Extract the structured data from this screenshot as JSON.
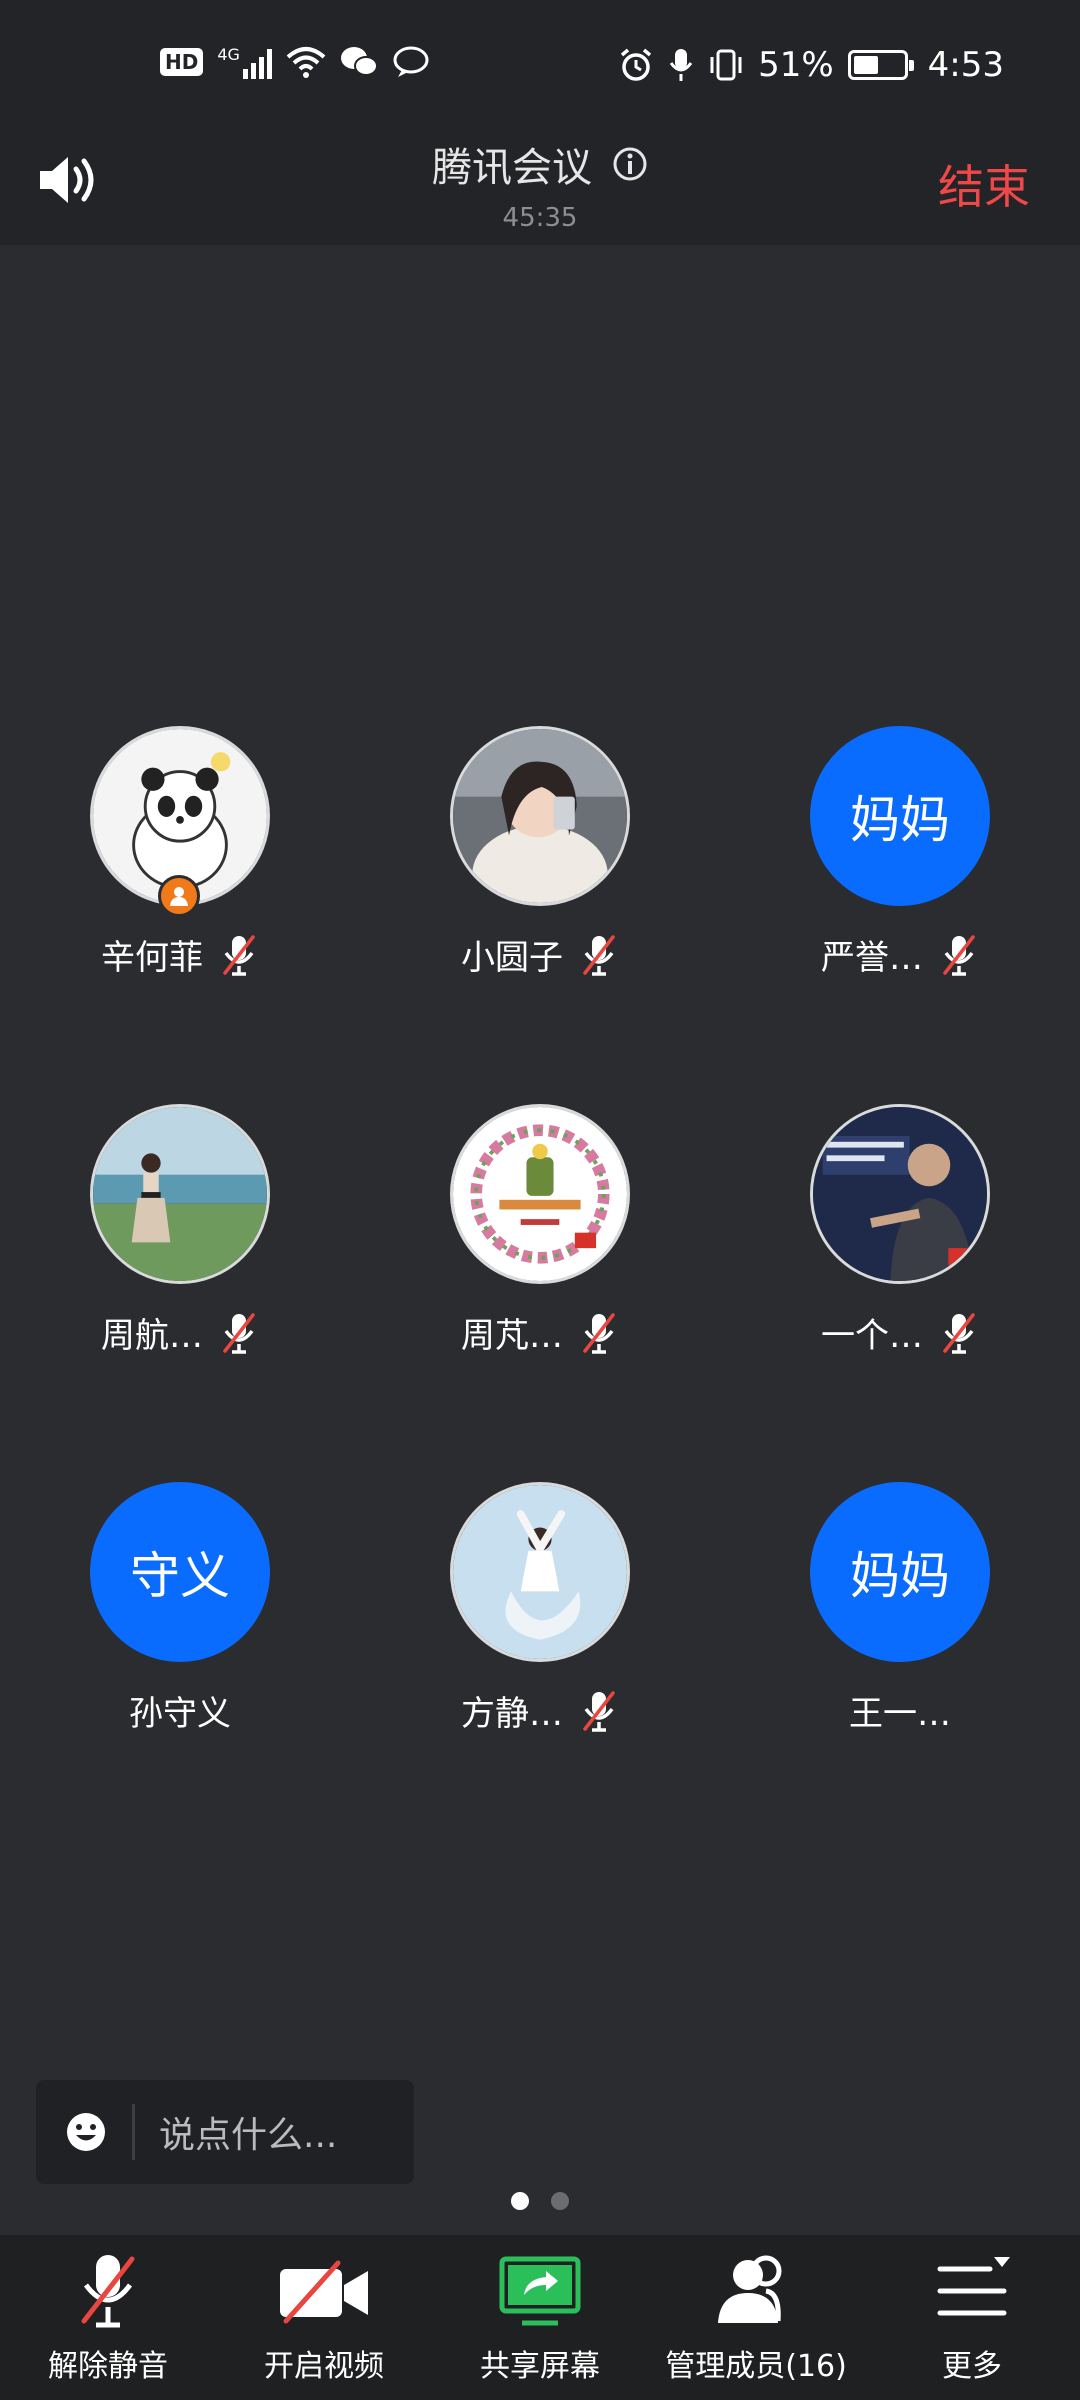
{
  "status_bar": {
    "hd": "HD",
    "network": "4G",
    "battery_percent": "51%",
    "battery_level": 0.51,
    "time": "4:53",
    "left_icons": [
      "hd-icon",
      "4g-signal-icon",
      "wifi-icon",
      "wechat-icon",
      "chat-bubble-icon"
    ],
    "right_icons": [
      "alarm-icon",
      "mic-icon",
      "vibrate-icon",
      "battery-icon"
    ]
  },
  "header": {
    "title": "腾讯会议",
    "timer": "45:35",
    "end_label": "结束"
  },
  "participants": [
    {
      "name": "辛何菲",
      "avatar": "panda",
      "muted": true,
      "host": true
    },
    {
      "name": "小圆子",
      "avatar": "photo-girl",
      "muted": true,
      "host": false
    },
    {
      "name": "严誉…",
      "avatar_text": "妈妈",
      "muted": true,
      "host": false
    },
    {
      "name": "周航…",
      "avatar": "photo-beach",
      "muted": true,
      "host": false
    },
    {
      "name": "周芃…",
      "avatar": "photo-wreath",
      "muted": true,
      "host": false
    },
    {
      "name": "一个…",
      "avatar": "photo-man",
      "muted": true,
      "host": false
    },
    {
      "name": "孙守义",
      "avatar_text": "守义",
      "muted": false,
      "host": false
    },
    {
      "name": "方静…",
      "avatar": "photo-dancer",
      "muted": true,
      "host": false
    },
    {
      "name": "王一…",
      "avatar_text": "妈妈",
      "muted": false,
      "host": false
    }
  ],
  "chat": {
    "placeholder": "说点什么..."
  },
  "pager": {
    "count": 2,
    "active": 0
  },
  "toolbar": [
    {
      "label": "解除静音",
      "icon": "mic-off-icon"
    },
    {
      "label": "开启视频",
      "icon": "video-off-icon"
    },
    {
      "label": "共享屏幕",
      "icon": "share-screen-icon"
    },
    {
      "label": "管理成员(16)",
      "icon": "members-icon"
    },
    {
      "label": "更多",
      "icon": "more-menu-icon"
    }
  ],
  "colors": {
    "background": "#2a2c2f",
    "bar": "#232427",
    "end_red": "#f04848",
    "avatar_blue": "#0a6cff",
    "share_green": "#2bbf5a",
    "mute_red": "#e8463f",
    "host_orange": "#f07a1a"
  }
}
